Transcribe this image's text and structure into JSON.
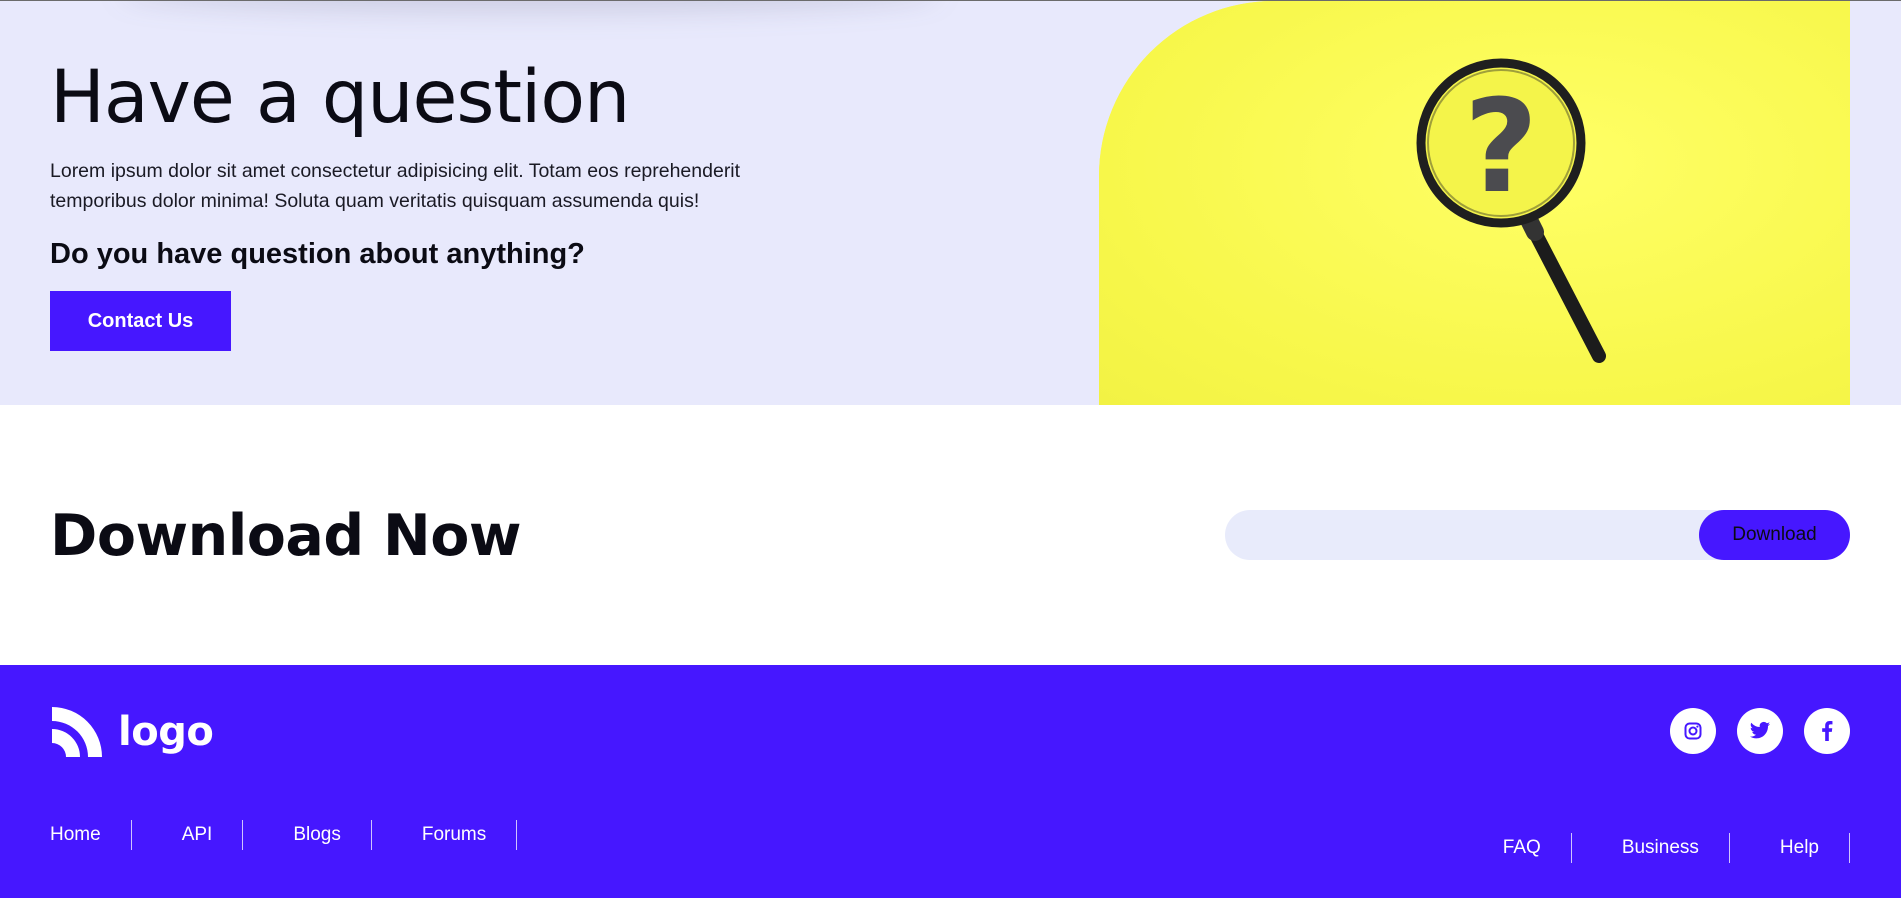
{
  "hero": {
    "title": "Have a question",
    "description": "Lorem ipsum dolor sit amet consectetur adipisicing elit. Totam eos reprehenderit temporibus dolor minima! Soluta quam veritatis quisquam assumenda quis!",
    "subtitle": "Do you have question about anything?",
    "contact_label": "Contact Us",
    "image_icon": "magnifying-glass-question-icon"
  },
  "download": {
    "title": "Download Now",
    "input_placeholder": "",
    "button_label": "Download"
  },
  "footer": {
    "logo_text": "logo",
    "logo_icon": "wifi-arcs-icon",
    "socials": [
      {
        "icon": "instagram-icon"
      },
      {
        "icon": "twitter-icon"
      },
      {
        "icon": "facebook-icon"
      }
    ],
    "nav_left": [
      {
        "label": "Home"
      },
      {
        "label": "API"
      },
      {
        "label": "Blogs"
      },
      {
        "label": "Forums"
      }
    ],
    "nav_right": [
      {
        "label": "FAQ"
      },
      {
        "label": "Business"
      },
      {
        "label": "Help"
      }
    ]
  },
  "colors": {
    "accent": "#4617ff",
    "hero_bg": "#e8e9fc",
    "image_bg": "#fbfb4e",
    "input_bg": "#e8ebfb"
  }
}
